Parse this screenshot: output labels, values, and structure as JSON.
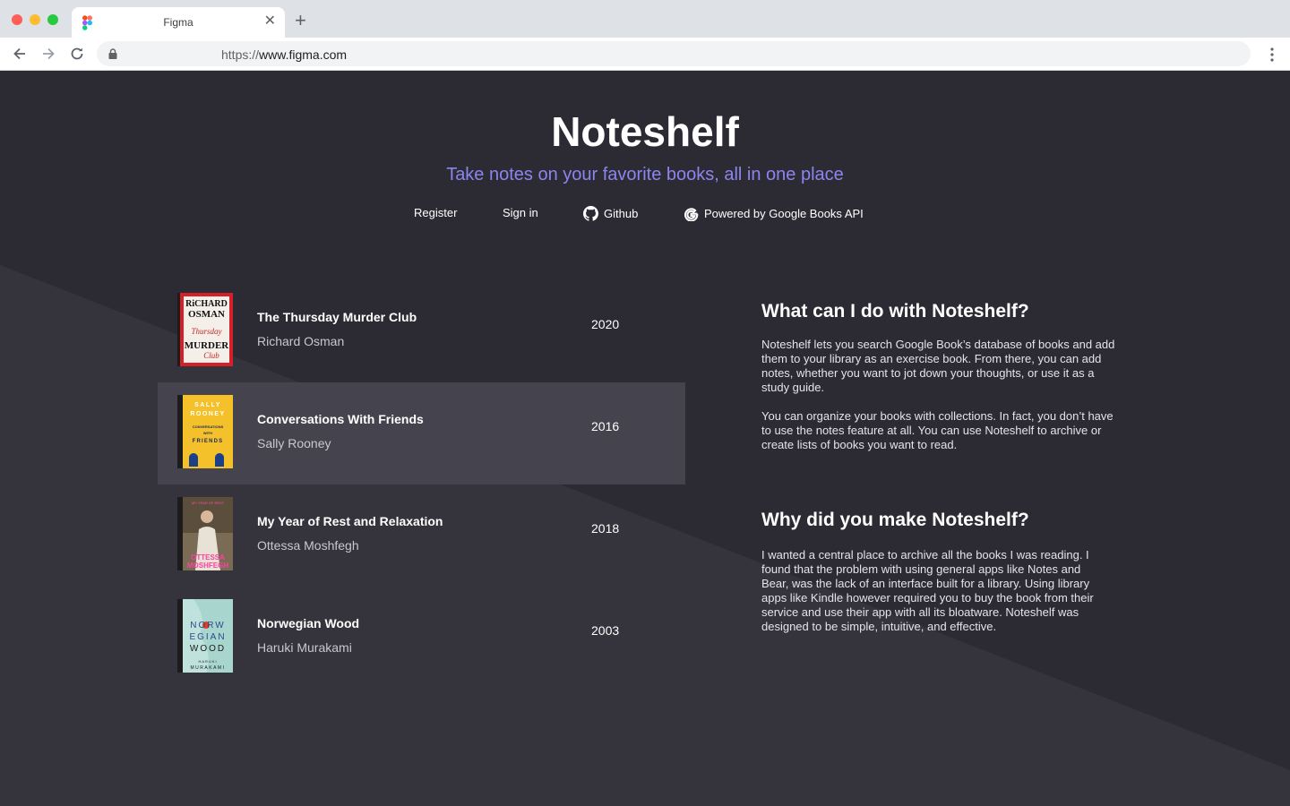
{
  "browser": {
    "tab_title": "Figma",
    "url_scheme": "https://",
    "url_host": "www.figma.com"
  },
  "hero": {
    "title": "Noteshelf",
    "subtitle": "Take notes on your favorite books, all in one place"
  },
  "nav": {
    "register": "Register",
    "sign_in": "Sign in",
    "github": "Github",
    "google_books": "Powered by Google Books API"
  },
  "books": [
    {
      "title": "The Thursday Murder Club",
      "author": "Richard Osman",
      "year": "2020",
      "cover_lines": [
        "RiCHARD",
        "OSMAN",
        "Thursday",
        "MURDER",
        "Club"
      ]
    },
    {
      "title": "Conversations With Friends",
      "author": "Sally Rooney",
      "year": "2016",
      "cover_lines": [
        "SALLY",
        "ROONEY",
        "CONVERSATIONS",
        "WITH",
        "FRIENDS"
      ]
    },
    {
      "title": "My Year of Rest and Relaxation",
      "author": "Ottessa Moshfegh",
      "year": "2018",
      "cover_lines": [
        "OTTESSA",
        "MOSHFEGH"
      ]
    },
    {
      "title": "Norwegian Wood",
      "author": "Haruki Murakami",
      "year": "2003",
      "cover_lines": [
        "NORW",
        "EGIAN",
        "WOOD",
        "HARUKI",
        "MURAKAMI"
      ]
    }
  ],
  "faq": [
    {
      "heading": "What can I do with Noteshelf?",
      "paragraphs": [
        "Noteshelf lets you search Google Book’s database of books and add them to your library as an exercise book. From there, you can add notes, whether you want to jot down your thoughts, or use it as a study guide.",
        "You can organize your books with collections. In fact, you don’t have to use the notes feature at all. You can use Noteshelf to archive or create lists of books you want to read."
      ]
    },
    {
      "heading": "Why did you make Noteshelf?",
      "paragraphs": [
        "I wanted a central place to archive all the books I was reading. I found that the problem with using general apps like Notes and Bear, was the lack of an interface built for a library. Using library apps like Kindle however required you to buy the book from their service and use their app with all its bloatware. Noteshelf was designed to be simple, intuitive, and effective."
      ]
    }
  ],
  "colors": {
    "background": "#2c2b33",
    "accent": "#8c85f0",
    "selected_row": "#45444e"
  }
}
